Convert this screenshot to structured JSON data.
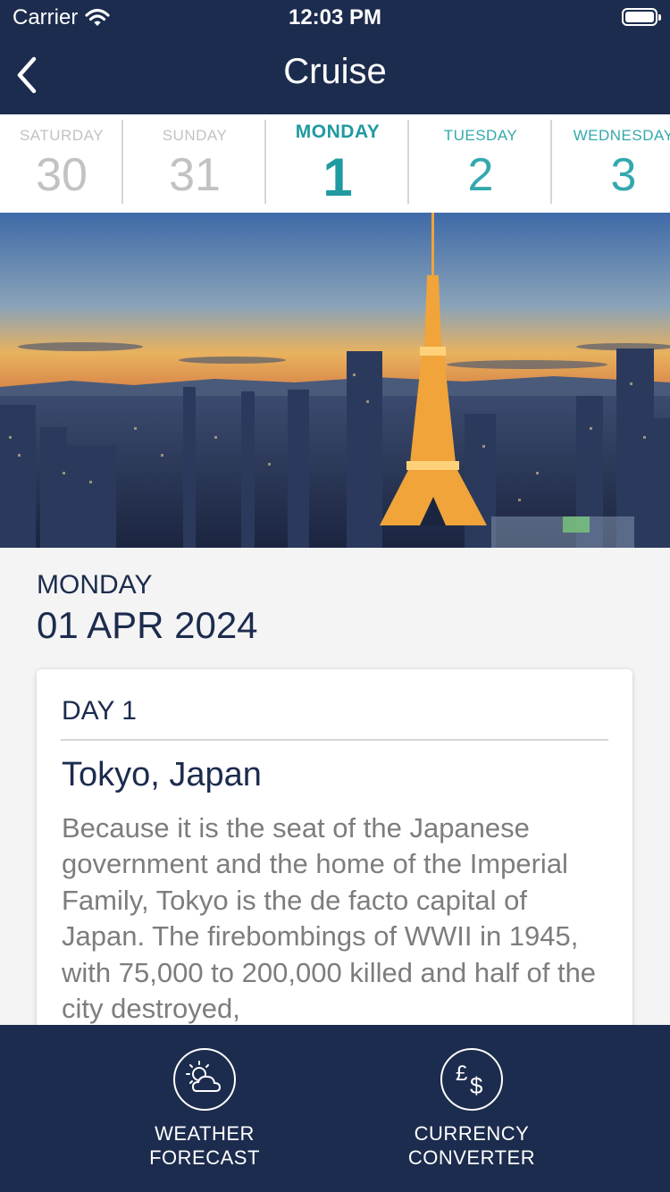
{
  "status": {
    "carrier": "Carrier",
    "time": "12:03 PM"
  },
  "nav": {
    "title": "Cruise"
  },
  "days": [
    {
      "name": "SATURDAY",
      "num": "30",
      "state": "past"
    },
    {
      "name": "SUNDAY",
      "num": "31",
      "state": "past"
    },
    {
      "name": "MONDAY",
      "num": "1",
      "state": "active"
    },
    {
      "name": "TUESDAY",
      "num": "2",
      "state": "future"
    },
    {
      "name": "WEDNESDAY",
      "num": "3",
      "state": "future"
    }
  ],
  "selected": {
    "weekday": "MONDAY",
    "date": "01 APR 2024"
  },
  "card": {
    "day_label": "DAY 1",
    "place": "Tokyo, Japan",
    "description": "Because it is the seat of the Japanese government and the home of the Imperial Family, Tokyo is the de facto capital of Japan. The firebombings of WWII in 1945, with 75,000 to 200,000 killed and half of the city destroyed,"
  },
  "tabs": {
    "weather": {
      "line1": "WEATHER",
      "line2": "FORECAST",
      "icon": "weather-icon"
    },
    "currency": {
      "line1": "CURRENCY",
      "line2": "CONVERTER",
      "icon": "currency-icon"
    }
  },
  "colors": {
    "navy": "#1c2c4e",
    "teal": "#1f9aa0",
    "muted": "#c2c2c2"
  }
}
